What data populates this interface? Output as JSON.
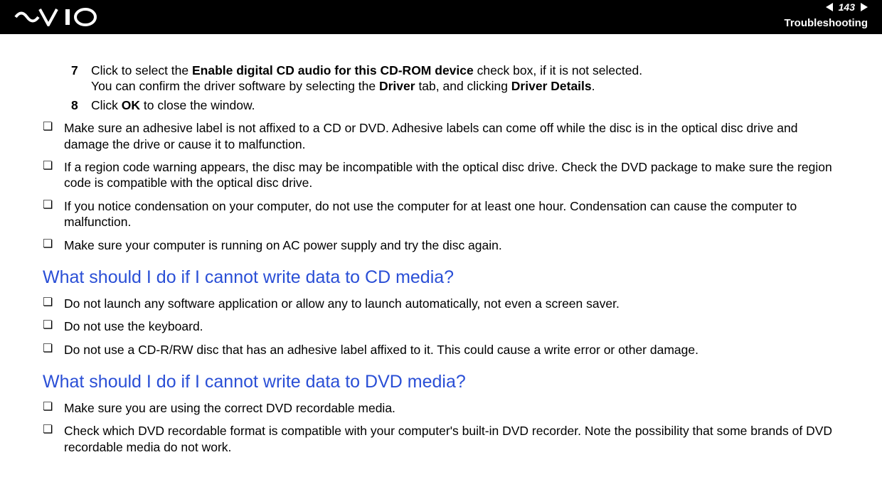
{
  "header": {
    "page_number": "143",
    "section": "Troubleshooting"
  },
  "steps": [
    {
      "num": "7",
      "line1_before": "Click to select the ",
      "line1_bold1": "Enable digital CD audio for this CD-ROM device",
      "line1_after": " check box, if it is not selected.",
      "line2_before": "You can confirm the driver software by selecting the ",
      "line2_bold1": "Driver",
      "line2_mid": " tab, and clicking ",
      "line2_bold2": "Driver Details",
      "line2_after": "."
    },
    {
      "num": "8",
      "line1_before": "Click ",
      "line1_bold1": "OK",
      "line1_after": " to close the window."
    }
  ],
  "bullets1": [
    "Make sure an adhesive label is not affixed to a CD or DVD. Adhesive labels can come off while the disc is in the optical disc drive and damage the drive or cause it to malfunction.",
    "If a region code warning appears, the disc may be incompatible with the optical disc drive. Check the DVD package to make sure the region code is compatible with the optical disc drive.",
    "If you notice condensation on your computer, do not use the computer for at least one hour. Condensation can cause the computer to malfunction.",
    "Make sure your computer is running on AC power supply and try the disc again."
  ],
  "heading1": "What should I do if I cannot write data to CD media?",
  "bullets2": [
    "Do not launch any software application or allow any to launch automatically, not even a screen saver.",
    "Do not use the keyboard.",
    "Do not use a CD-R/RW disc that has an adhesive label affixed to it. This could cause a write error or other damage."
  ],
  "heading2": "What should I do if I cannot write data to DVD media?",
  "bullets3": [
    "Make sure you are using the correct DVD recordable media.",
    "Check which DVD recordable format is compatible with your computer's built-in DVD recorder. Note the possibility that some brands of DVD recordable media do not work."
  ]
}
